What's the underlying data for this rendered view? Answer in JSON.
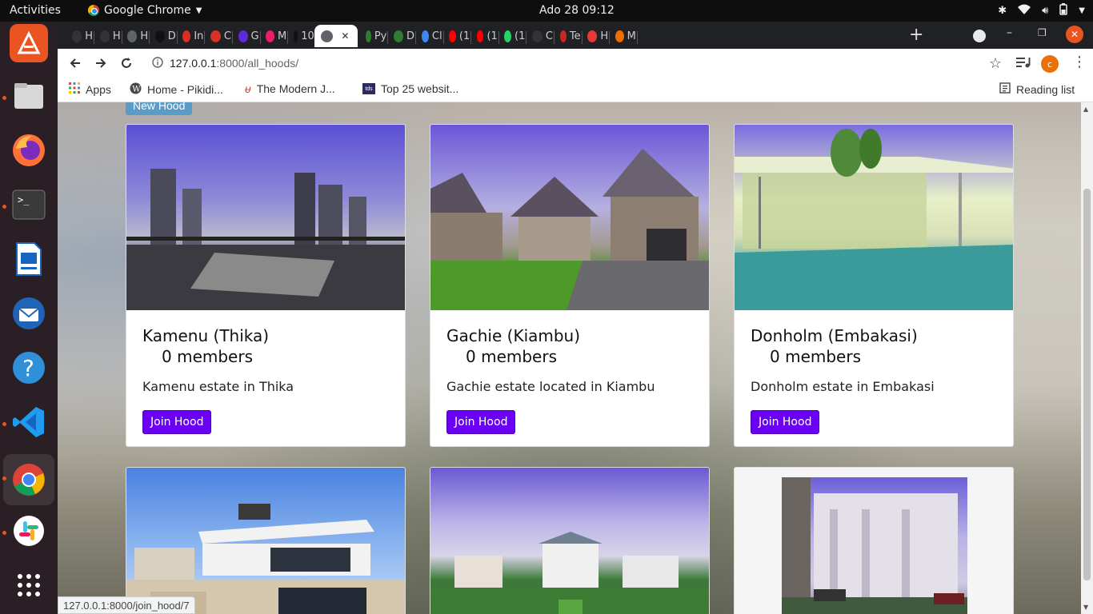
{
  "system": {
    "activities": "Activities",
    "app_name": "Google Chrome",
    "clock": "Ado 28  09:12"
  },
  "tabs": [
    {
      "label": "H",
      "color": "#333"
    },
    {
      "label": "H",
      "color": "#333"
    },
    {
      "label": "H",
      "color": "#5f6368"
    },
    {
      "label": "D",
      "color": "#111"
    },
    {
      "label": "In",
      "color": "#d93025"
    },
    {
      "label": "C",
      "color": "#d93025"
    },
    {
      "label": "G",
      "color": "#5b2bdb"
    },
    {
      "label": "M",
      "color": "#e91e63"
    },
    {
      "label": "10",
      "color": "#111"
    },
    {
      "label": "",
      "color": "#5f6368",
      "active": true
    },
    {
      "label": "Py",
      "color": "#2e7d32"
    },
    {
      "label": "D",
      "color": "#2e7d32"
    },
    {
      "label": "Cl",
      "color": "#4285f4"
    },
    {
      "label": "(1",
      "color": "#ff0000"
    },
    {
      "label": "(1",
      "color": "#ff0000"
    },
    {
      "label": "(1",
      "color": "#25d366"
    },
    {
      "label": "C",
      "color": "#333"
    },
    {
      "label": "Te",
      "color": "#c62828"
    },
    {
      "label": "H",
      "color": "#e53935"
    },
    {
      "label": "M",
      "color": "#ef6c00"
    }
  ],
  "address": {
    "url_host": "127.0.0.1",
    "url_path": ":8000/all_hoods/",
    "profile_initial": "c"
  },
  "bookmarks": {
    "apps": "Apps",
    "items": [
      "Home - Pikidi...",
      "The Modern J...",
      "Top 25 websit..."
    ],
    "reading_list": "Reading list"
  },
  "page": {
    "new_hood_label": "New Hood",
    "cards": [
      {
        "name": "Kamenu (Thika)",
        "members": "0 members",
        "description": "Kamenu estate in Thika",
        "button": "Join Hood"
      },
      {
        "name": "Gachie (Kiambu)",
        "members": "0 members",
        "description": "Gachie estate located in Kiambu",
        "button": "Join Hood"
      },
      {
        "name": "Donholm (Embakasi)",
        "members": "0 members",
        "description": "Donholm estate in Embakasi",
        "button": "Join Hood"
      }
    ]
  },
  "status_url": "127.0.0.1:8000/join_hood/7"
}
